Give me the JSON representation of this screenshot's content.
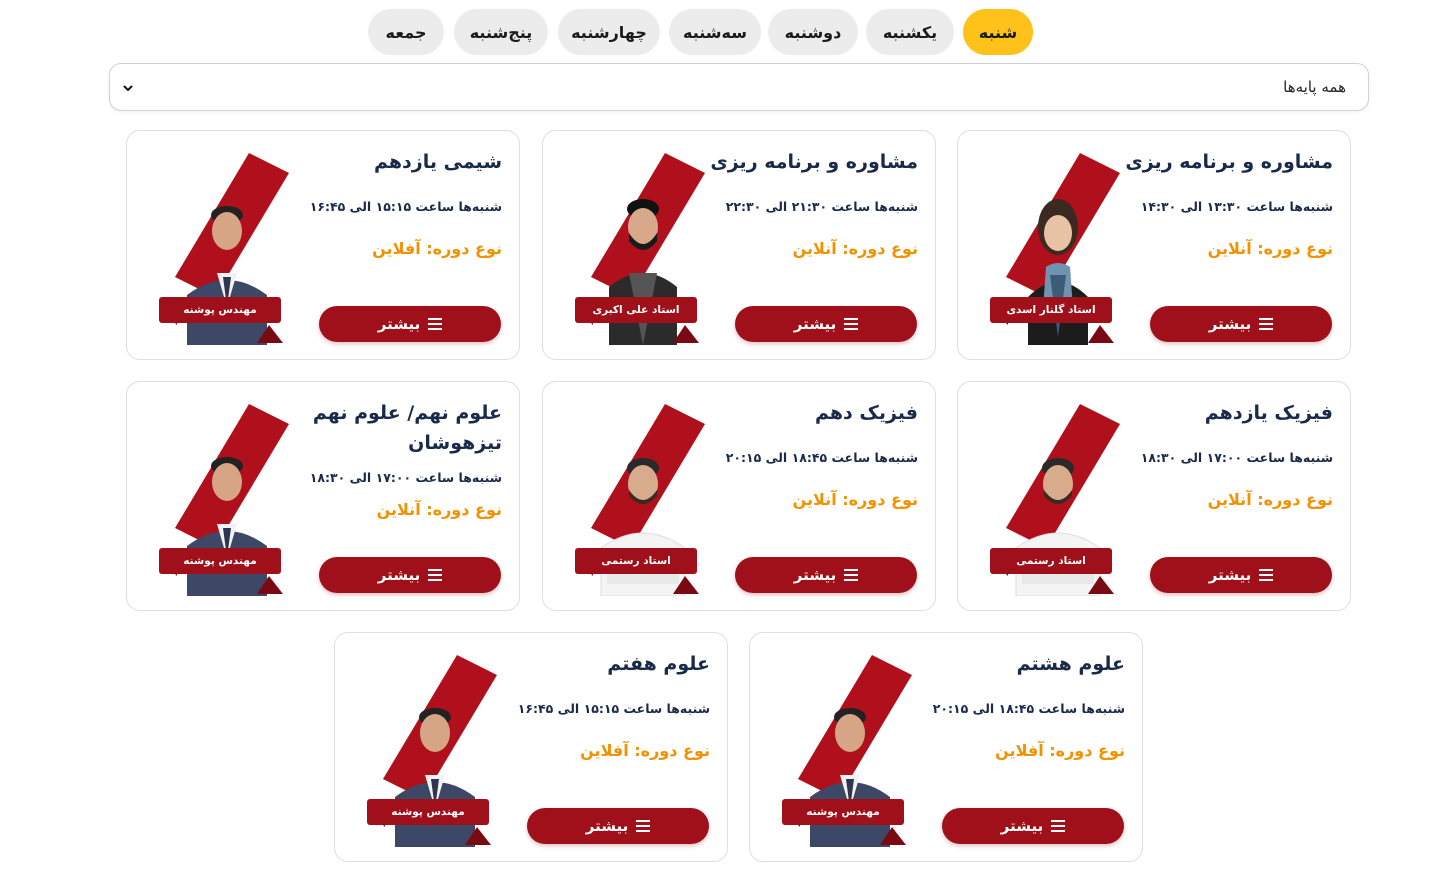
{
  "days": [
    {
      "label": "شنبه",
      "active": true
    },
    {
      "label": "یکشنبه",
      "active": false
    },
    {
      "label": "دوشنبه",
      "active": false
    },
    {
      "label": "سه‌شنبه",
      "active": false
    },
    {
      "label": "چهارشنبه",
      "active": false
    },
    {
      "label": "پنج‌شنبه",
      "active": false
    },
    {
      "label": "جمعه",
      "active": false
    }
  ],
  "grade_select": {
    "value": "همه پایه‌ها"
  },
  "colors": {
    "accent": "#ffc21a",
    "brand": "#a0101a",
    "type_text": "#f39200",
    "title_text": "#1a2a4a"
  },
  "more_label": "بیشتر",
  "courses": [
    {
      "title": "مشاوره و برنامه ریزی",
      "time": "شنبه‌ها ساعت ۱۳:۳۰ الی ۱۴:۳۰",
      "type": "نوع دوره: آنلاین",
      "teacher": "استاد گلنار اسدی",
      "avatar": "woman-scarf"
    },
    {
      "title": "مشاوره و برنامه ریزی",
      "time": "شنبه‌ها ساعت ۲۱:۳۰ الی ۲۲:۳۰",
      "type": "نوع دوره: آنلاین",
      "teacher": "استاد علی اکبری",
      "avatar": "man-vest"
    },
    {
      "title": "شیمی یازدهم",
      "time": "شنبه‌ها ساعت ۱۵:۱۵ الی ۱۶:۴۵",
      "type": "نوع دوره: آفلاین",
      "teacher": "مهندس پوشنه",
      "avatar": "man-suit"
    },
    {
      "title": "فیزیک یازدهم",
      "time": "شنبه‌ها ساعت ۱۷:۰۰ الی ۱۸:۳۰",
      "type": "نوع دوره: آنلاین",
      "teacher": "استاد رستمی",
      "avatar": "man-white-shirt"
    },
    {
      "title": "فیزیک دهم",
      "time": "شنبه‌ها ساعت ۱۸:۴۵ الی ۲۰:۱۵",
      "type": "نوع دوره: آنلاین",
      "teacher": "استاد رستمی",
      "avatar": "man-white-shirt"
    },
    {
      "title": "علوم نهم/ علوم نهم تیزهوشان",
      "time": "شنبه‌ها ساعت ۱۷:۰۰ الی ۱۸:۳۰",
      "type": "نوع دوره: آنلاین",
      "teacher": "مهندس پوشنه",
      "avatar": "man-suit"
    },
    {
      "title": "علوم هشتم",
      "time": "شنبه‌ها ساعت ۱۸:۴۵ الی ۲۰:۱۵",
      "type": "نوع دوره: آفلاین",
      "teacher": "مهندس پوشنه",
      "avatar": "man-suit"
    },
    {
      "title": "علوم هفتم",
      "time": "شنبه‌ها ساعت ۱۵:۱۵ الی ۱۶:۴۵",
      "type": "نوع دوره: آفلاین",
      "teacher": "مهندس پوشنه",
      "avatar": "man-suit"
    }
  ]
}
